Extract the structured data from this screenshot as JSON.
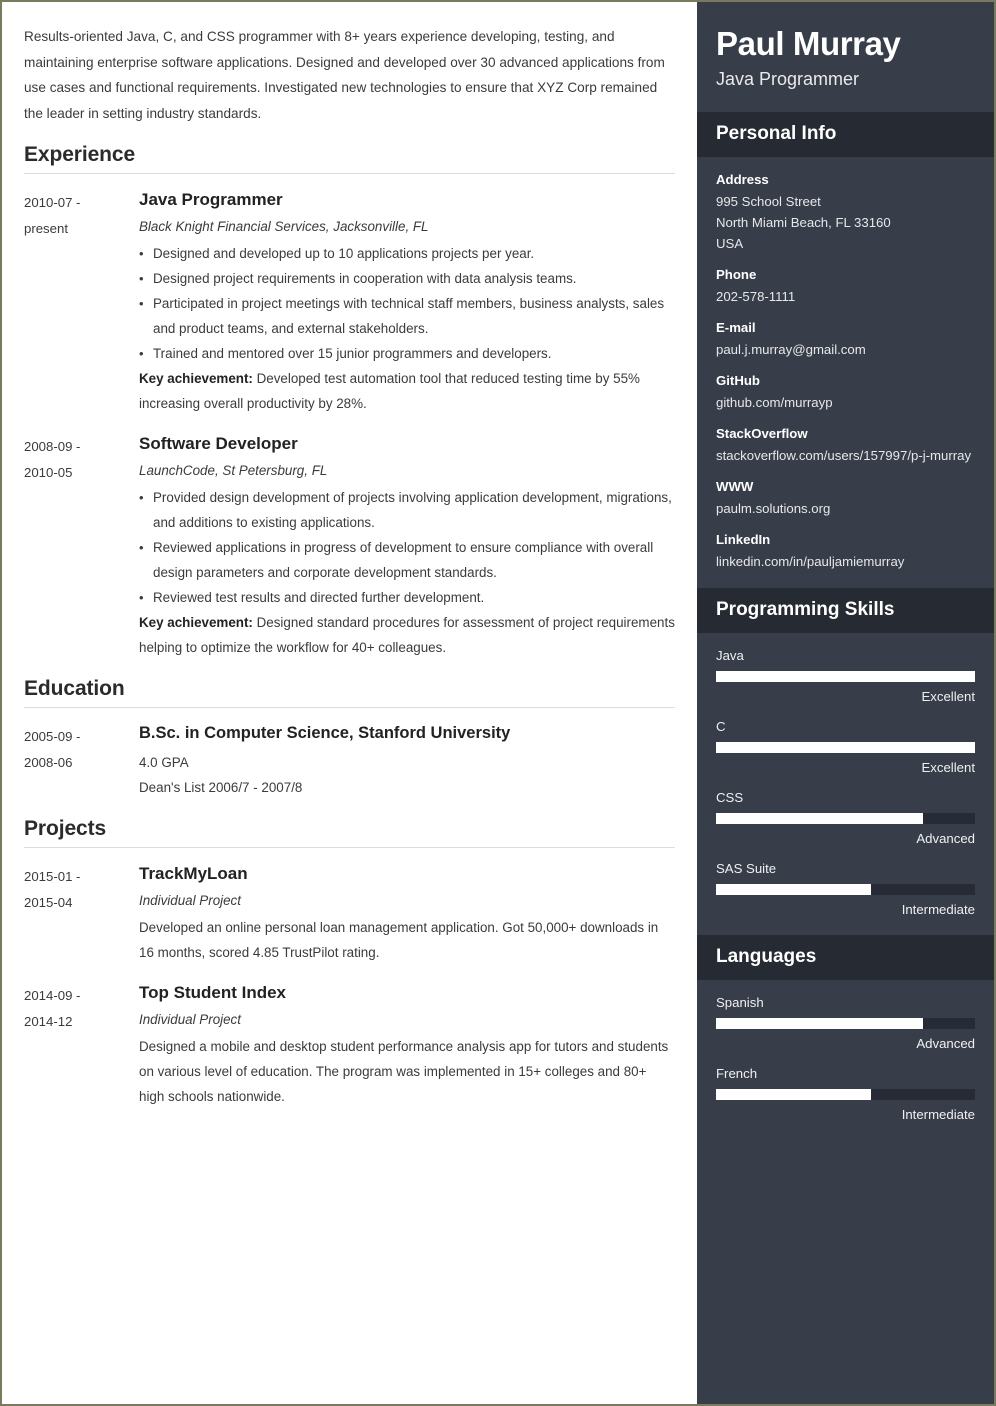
{
  "colors": {
    "sidebar_bg": "#373d49",
    "sidebar_header_bg": "#252a33",
    "bar_fill": "#ffffff",
    "bar_track": "#262b35",
    "page_border": "#7a7a5c",
    "text_dark": "#3b3b3b"
  },
  "main": {
    "summary": "Results-oriented Java, C, and CSS programmer with 8+ years experience developing, testing, and maintaining enterprise software applications. Designed and developed over 30 advanced applications from use cases and functional requirements. Investigated new technologies to ensure that XYZ Corp remained the leader in setting industry standards.",
    "sections": [
      {
        "title": "Experience",
        "entries": [
          {
            "date_from": "2010-07 -",
            "date_to": "present",
            "title": "Java Programmer",
            "subtitle": "Black Knight Financial Services, Jacksonville, FL",
            "bullets": [
              "Designed and developed up to 10 applications projects per year.",
              "Designed project requirements in cooperation with data analysis teams.",
              "Participated in project meetings with technical staff members, business analysts, sales and product teams, and external stakeholders.",
              "Trained and mentored over 15 junior programmers and developers."
            ],
            "achievement_label": "Key achievement:",
            "achievement_text": " Developed test automation tool that reduced testing time by 55% increasing overall productivity by 28%."
          },
          {
            "date_from": "2008-09 -",
            "date_to": "2010-05",
            "title": "Software Developer",
            "subtitle": "LaunchCode, St Petersburg, FL",
            "bullets": [
              "Provided design development of projects involving application development, migrations, and additions to existing applications.",
              "Reviewed applications in progress of development to ensure compliance with overall design parameters and corporate development standards.",
              "Reviewed test results and directed further development."
            ],
            "achievement_label": "Key achievement:",
            "achievement_text": " Designed standard procedures for assessment of project requirements helping to optimize the workflow for 40+ colleagues."
          }
        ]
      },
      {
        "title": "Education",
        "entries": [
          {
            "date_from": "2005-09 -",
            "date_to": "2008-06",
            "title": "B.Sc. in Computer Science, Stanford University",
            "lines": [
              "4.0 GPA",
              "Dean's List 2006/7 - 2007/8"
            ]
          }
        ]
      },
      {
        "title": "Projects",
        "entries": [
          {
            "date_from": "2015-01 -",
            "date_to": "2015-04",
            "title": "TrackMyLoan",
            "subtitle": "Individual Project",
            "description": "Developed an online personal loan management application. Got 50,000+ downloads in 16 months, scored 4.85 TrustPilot rating."
          },
          {
            "date_from": "2014-09 -",
            "date_to": "2014-12",
            "title": "Top Student Index",
            "subtitle": "Individual Project",
            "description": "Designed a mobile and desktop student performance analysis app for tutors and students on various level of education. The program was implemented in 15+ colleges and 80+ high schools nationwide."
          }
        ]
      }
    ]
  },
  "sidebar": {
    "name": "Paul Murray",
    "role": "Java Programmer",
    "personal_info": {
      "title": "Personal Info",
      "items": [
        {
          "label": "Address",
          "lines": [
            "995 School Street",
            "North Miami Beach, FL 33160",
            "USA"
          ]
        },
        {
          "label": "Phone",
          "lines": [
            "202-578-1111"
          ]
        },
        {
          "label": "E-mail",
          "lines": [
            "paul.j.murray@gmail.com"
          ]
        },
        {
          "label": "GitHub",
          "lines": [
            "github.com/murrayp"
          ]
        },
        {
          "label": "StackOverflow",
          "lines": [
            "stackoverflow.com/users/157997/p-j-murray"
          ]
        },
        {
          "label": "WWW",
          "lines": [
            "paulm.solutions.org"
          ]
        },
        {
          "label": "LinkedIn",
          "lines": [
            "linkedin.com/in/pauljamiemurray"
          ]
        }
      ]
    },
    "programming_skills": {
      "title": "Programming Skills",
      "items": [
        {
          "name": "Java",
          "level": "Excellent",
          "percent": 100
        },
        {
          "name": "C",
          "level": "Excellent",
          "percent": 100
        },
        {
          "name": "CSS",
          "level": "Advanced",
          "percent": 80
        },
        {
          "name": "SAS Suite",
          "level": "Intermediate",
          "percent": 60
        }
      ]
    },
    "languages": {
      "title": "Languages",
      "items": [
        {
          "name": "Spanish",
          "level": "Advanced",
          "percent": 80
        },
        {
          "name": "French",
          "level": "Intermediate",
          "percent": 60
        }
      ]
    }
  }
}
